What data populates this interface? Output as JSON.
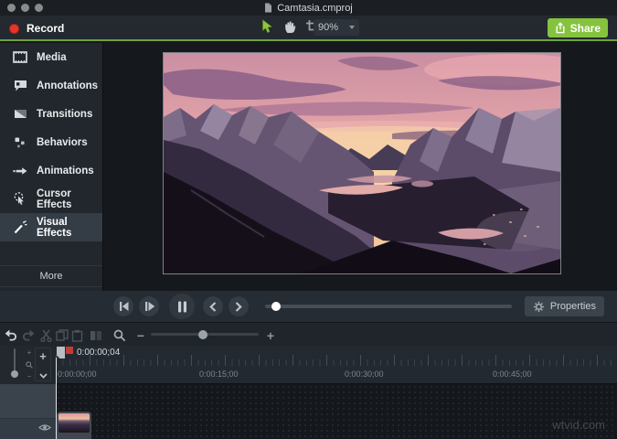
{
  "window": {
    "title": "Camtasia.cmproj"
  },
  "toolbar": {
    "record_label": "Record",
    "zoom_value": "90%",
    "share_label": "Share"
  },
  "sidebar": {
    "items": [
      {
        "label": "Media"
      },
      {
        "label": "Annotations"
      },
      {
        "label": "Transitions"
      },
      {
        "label": "Behaviors"
      },
      {
        "label": "Animations"
      },
      {
        "label": "Cursor Effects"
      },
      {
        "label": "Visual Effects",
        "selected": true
      }
    ],
    "more_label": "More"
  },
  "playback": {
    "properties_label": "Properties"
  },
  "timeline": {
    "playhead_time": "0:00:00;04",
    "ruler_labels": [
      "0:00:00;00",
      "0:00:15;00",
      "0:00:30;00",
      "0:00:45;00"
    ]
  },
  "glyphs": {
    "plus": "+",
    "minus": "−"
  },
  "watermark": "wtvid.com",
  "colors": {
    "accent_green": "#85c33f",
    "record_red": "#e8352b",
    "playhead_red": "#c53b36"
  }
}
